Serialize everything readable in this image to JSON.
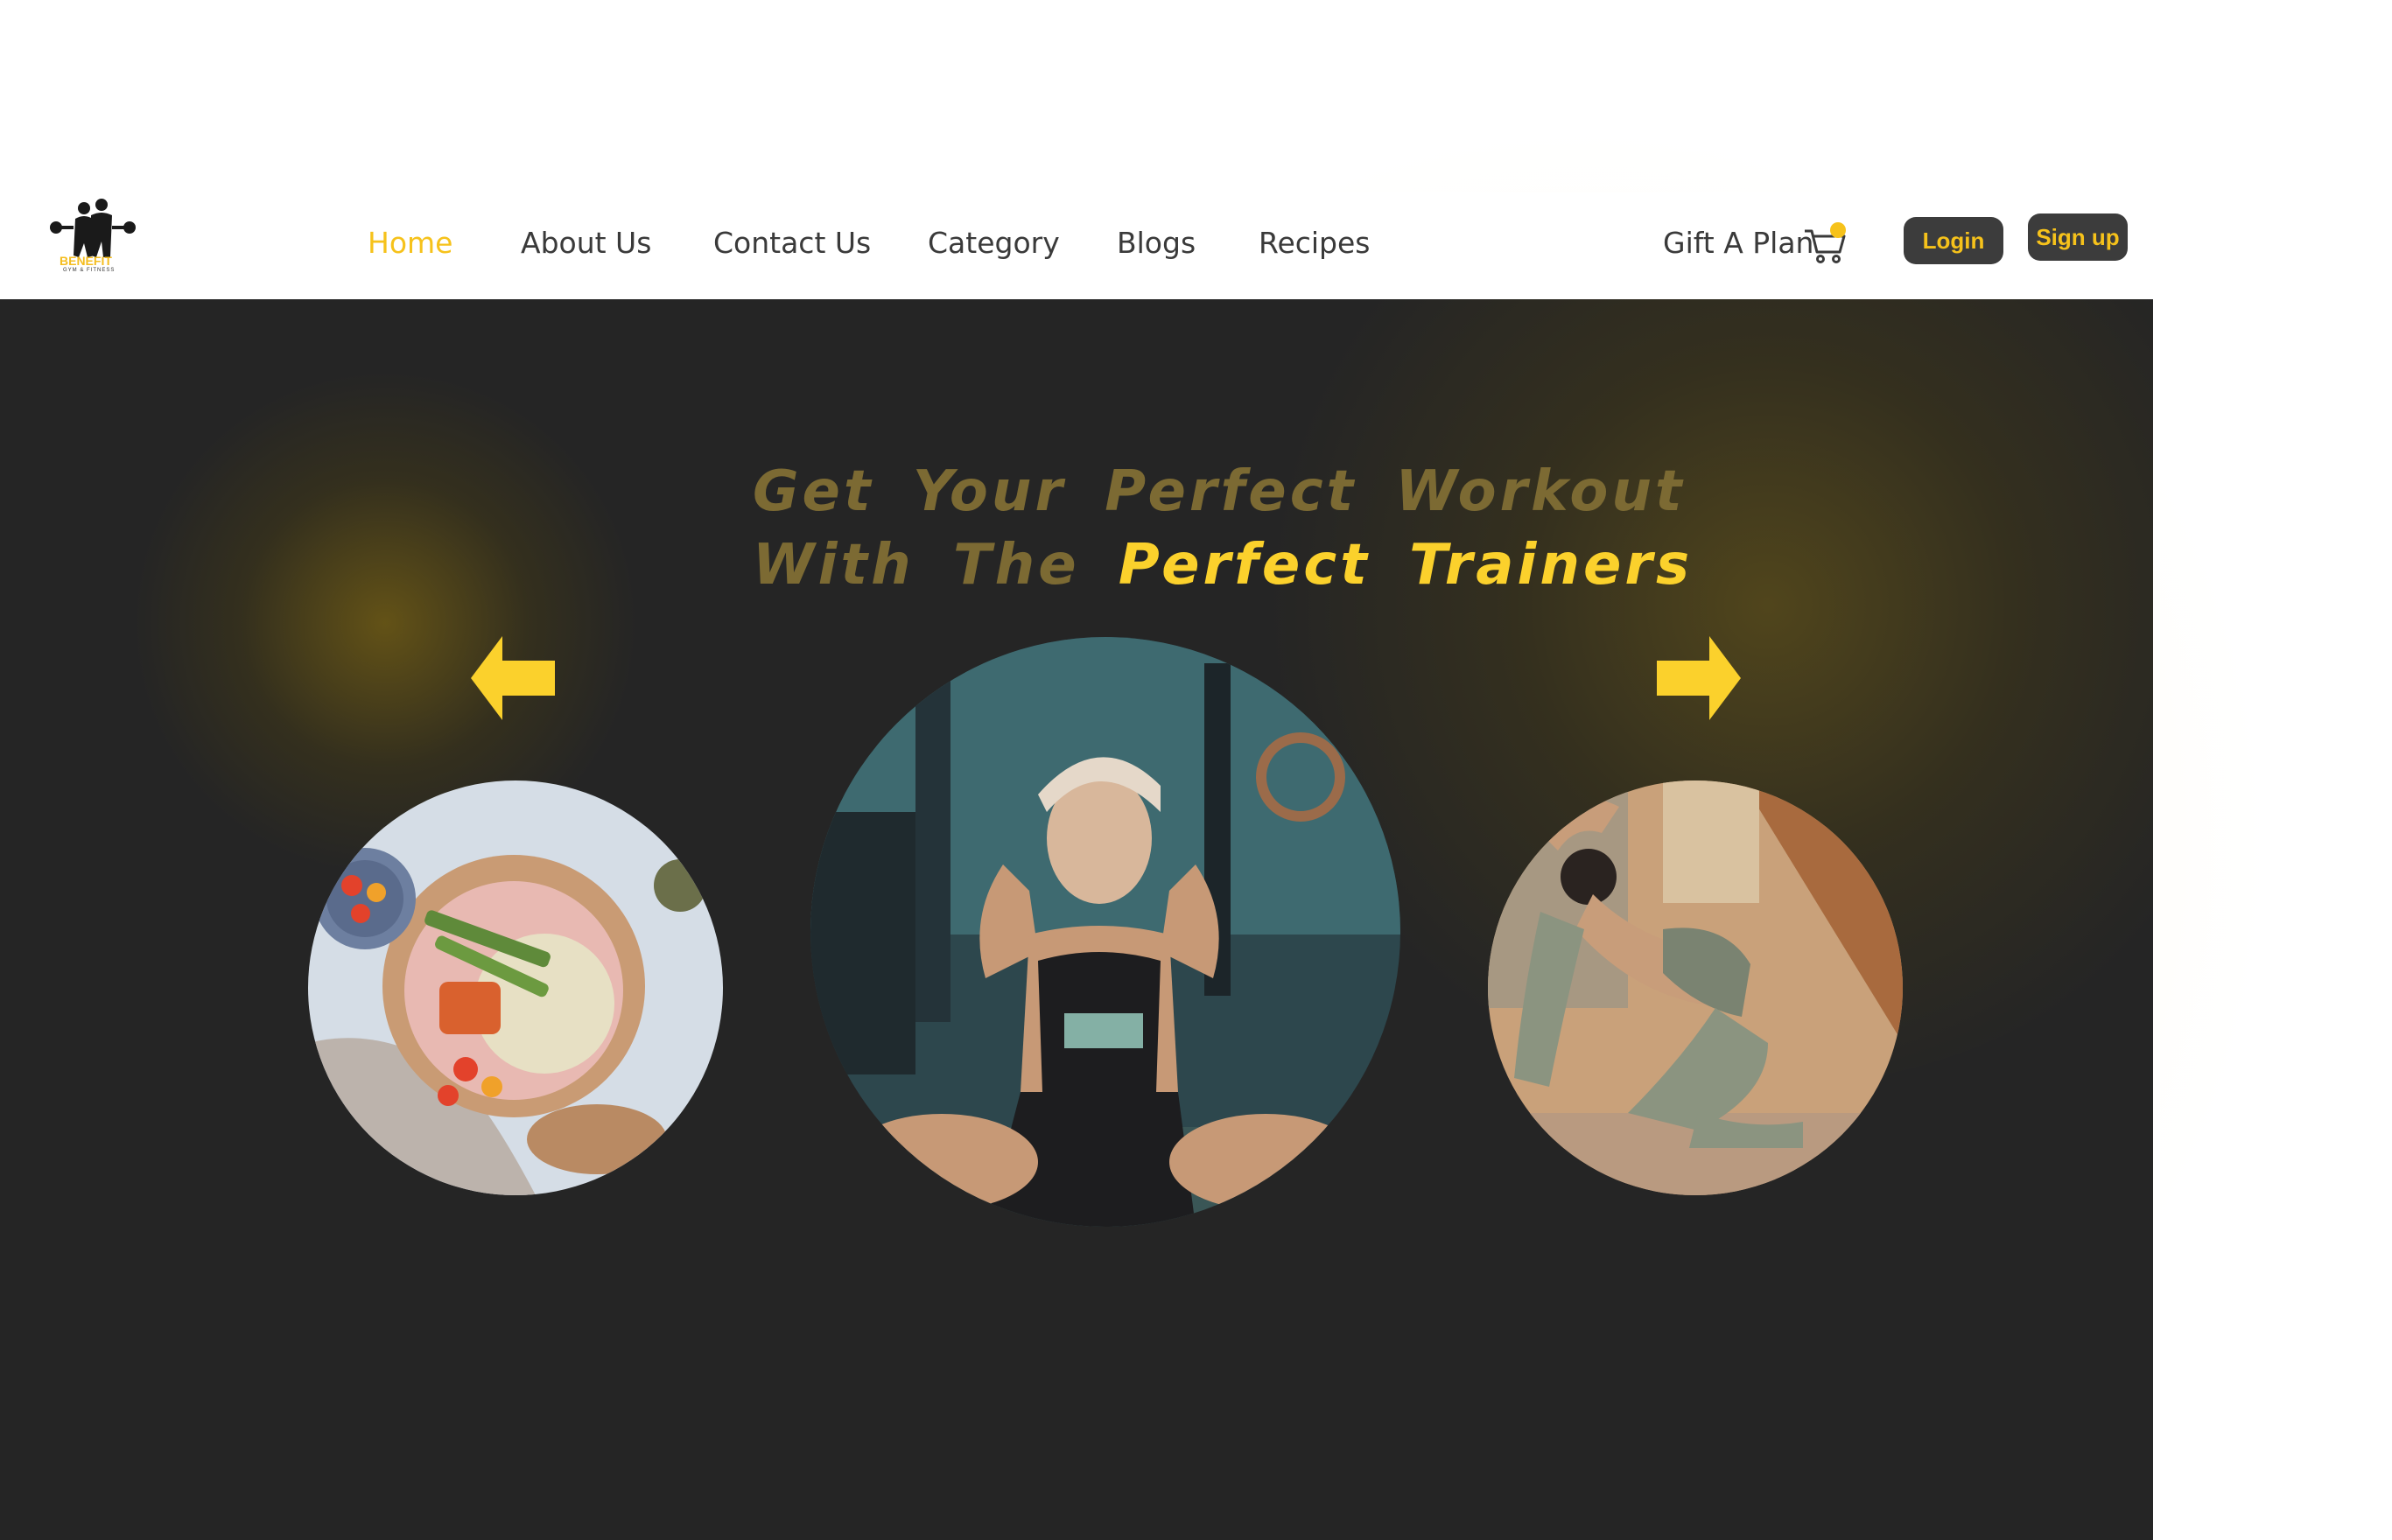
{
  "brand": {
    "name": "BENEFIT",
    "tagline": "GYM & FITNESS",
    "accent_color": "#f6c21b",
    "dark_background": "#252525"
  },
  "nav": {
    "items": [
      {
        "label": "Home",
        "active": true
      },
      {
        "label": "About Us",
        "active": false
      },
      {
        "label": "Contact Us",
        "active": false
      },
      {
        "label": "Category",
        "active": false
      },
      {
        "label": "Blogs",
        "active": false
      },
      {
        "label": "Recipes",
        "active": false
      }
    ]
  },
  "header_actions": {
    "gift_label": "Gift A Plan",
    "cart_icon": "shopping-cart-icon",
    "login_label": "Login",
    "signup_label": "Sign up"
  },
  "hero": {
    "headline_line1": "Get Your Perfect Workout",
    "headline_line2_prefix": "With The",
    "headline_line2_highlight": "Perfect Trainers",
    "prev_icon": "arrow-left-icon",
    "next_icon": "arrow-right-icon",
    "slides": [
      {
        "image": "healthy-food-bowl"
      },
      {
        "image": "woman-doing-situps"
      },
      {
        "image": "woman-doing-yoga-pose"
      }
    ]
  }
}
